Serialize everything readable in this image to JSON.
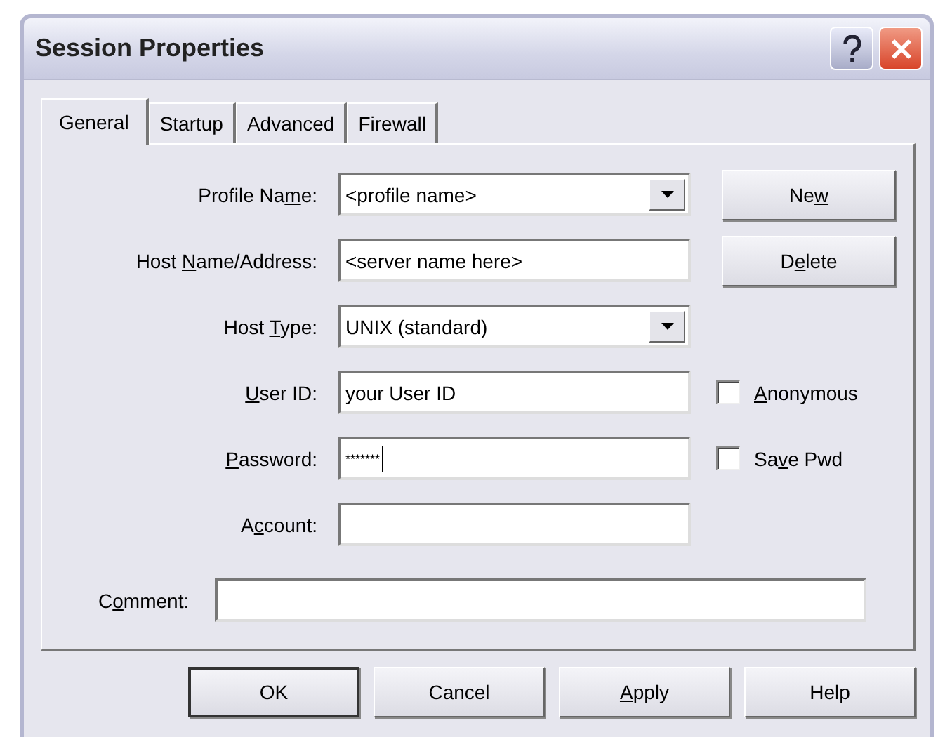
{
  "window": {
    "title": "Session Properties"
  },
  "tabs": [
    {
      "label": "General",
      "selected": true
    },
    {
      "label": "Startup",
      "selected": false
    },
    {
      "label": "Advanced",
      "selected": false
    },
    {
      "label": "Firewall",
      "selected": false
    }
  ],
  "fields": [
    {
      "kind": "combo",
      "label": {
        "before": "Profile Na",
        "key": "m",
        "after": "e:"
      },
      "value": "<profile name>",
      "side": {
        "kind": "button",
        "label": {
          "before": "Ne",
          "key": "w"
        }
      }
    },
    {
      "kind": "text",
      "label": {
        "before": "Host ",
        "key": "N",
        "after": "ame/Address:"
      },
      "value": "<server name here>",
      "side": {
        "kind": "button",
        "label": {
          "before": "D",
          "key": "e",
          "after": "lete"
        }
      }
    },
    {
      "kind": "combo",
      "label": {
        "before": "Host ",
        "key": "T",
        "after": "ype:"
      },
      "value": "UNIX (standard)"
    },
    {
      "kind": "text",
      "label": {
        "key": "U",
        "after": "ser ID:"
      },
      "value": "your User ID",
      "side": {
        "kind": "checkbox",
        "checked": false,
        "label": {
          "key": "A",
          "after": "nonymous"
        }
      }
    },
    {
      "kind": "text",
      "label": {
        "key": "P",
        "after": "assword:"
      },
      "value": "*******",
      "focused": true,
      "side": {
        "kind": "checkbox",
        "checked": false,
        "label": {
          "before": "Sa",
          "key": "v",
          "after": "e Pwd"
        }
      }
    },
    {
      "kind": "text",
      "label": {
        "before": "A",
        "key": "c",
        "after": "count:"
      }
    }
  ],
  "comment": {
    "label": {
      "before": "C",
      "key": "o",
      "after": "mment:"
    }
  },
  "buttons": [
    {
      "label": {
        "before": "OK"
      },
      "default": true
    },
    {
      "label": {
        "before": "Cancel"
      },
      "default": false
    },
    {
      "label": {
        "key": "A",
        "after": "pply"
      },
      "default": false
    },
    {
      "label": {
        "before": "Help"
      },
      "default": false
    }
  ]
}
